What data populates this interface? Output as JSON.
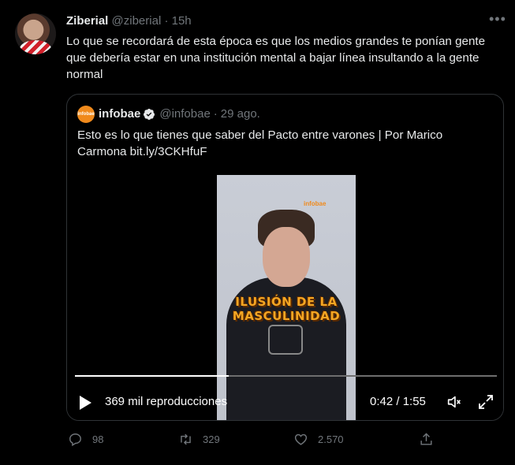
{
  "tweet": {
    "author_name": "Ziberial",
    "author_handle": "@ziberial",
    "separator": "·",
    "time": "15h",
    "more_icon": "more-horizontal-icon",
    "text": "Lo que se recordará de esta época es que los medios grandes te ponían gente que debería estar en una institución mental a bajar línea insultando a la gente normal"
  },
  "quote": {
    "logo_text": "infobae",
    "author_name": "infobae",
    "author_handle": "@infobae",
    "separator": "·",
    "date": "29 ago.",
    "text": "Esto es lo que tienes que saber del Pacto entre varones | Por Marico Carmona bit.ly/3CKHfuF",
    "video": {
      "watermark": "infobae",
      "caption_line1": "ILUSIÓN DE LA",
      "caption_line2": "MASCULINIDAD",
      "views": "369 mil reproducciones",
      "time": "0:42 / 1:55",
      "progress": 0.365
    }
  },
  "actions": {
    "replies": "98",
    "retweets": "329",
    "likes": "2.570"
  }
}
